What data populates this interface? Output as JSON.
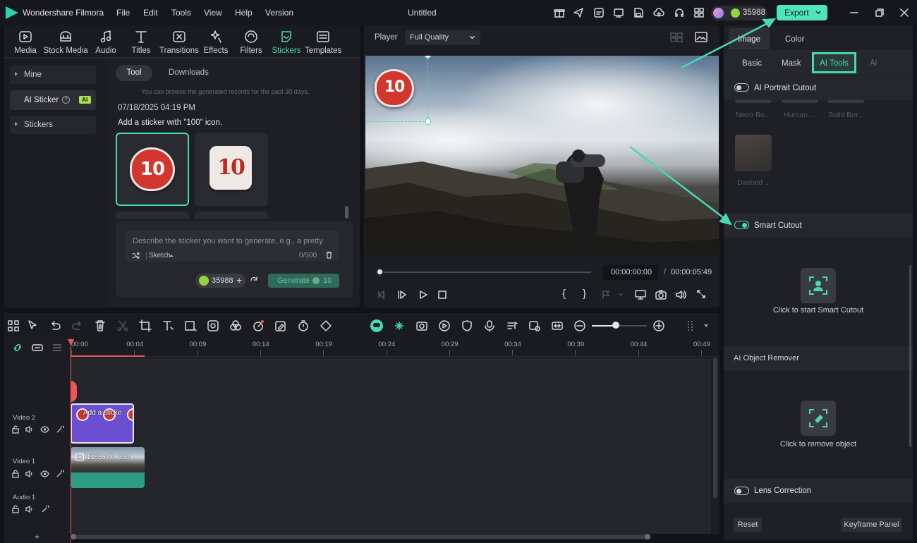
{
  "app": {
    "name": "Wondershare Filmora",
    "doc_title": "Untitled",
    "credits": "35988",
    "export_label": "Export"
  },
  "menu": [
    "File",
    "Edit",
    "Tools",
    "View",
    "Help",
    "Version"
  ],
  "toolbar": [
    {
      "label": "Media",
      "icon": "media-icon"
    },
    {
      "label": "Stock Media",
      "icon": "stock-media-icon"
    },
    {
      "label": "Audio",
      "icon": "audio-icon"
    },
    {
      "label": "Titles",
      "icon": "titles-icon"
    },
    {
      "label": "Transitions",
      "icon": "transitions-icon"
    },
    {
      "label": "Effects",
      "icon": "effects-icon"
    },
    {
      "label": "Filters",
      "icon": "filters-icon"
    },
    {
      "label": "Stickers",
      "icon": "stickers-icon",
      "active": true
    },
    {
      "label": "Templates",
      "icon": "templates-icon"
    }
  ],
  "sidebar": {
    "mine": "Mine",
    "ai_sticker": "AI Sticker",
    "ai_badge": "AI",
    "stickers": "Stickers"
  },
  "sticker_panel": {
    "tab_tool": "Tool",
    "tab_downloads": "Downloads",
    "notice": "You can browse the generated records for the past 30 days.",
    "date": "07/18/2025 04:19 PM",
    "prompt": "Add a sticker with \"100\" icon.",
    "input_placeholder": "Describe the sticker you want to generate, e.g., a pretty",
    "style": "Sketch",
    "counter": "0/500",
    "credits": "35988",
    "generate_label": "Generate",
    "generate_cost": "10",
    "sticker_text": "10"
  },
  "player": {
    "label": "Player",
    "quality": "Full Quality",
    "current_time": "00:00:00:00",
    "separator": "/",
    "total_time": "00:00:05:49",
    "playhead_fraction": 0.0
  },
  "timeline": {
    "ruler": [
      "00:00",
      "00:04",
      "00:09",
      "00:14",
      "00:19",
      "00:24",
      "00:29",
      "00:34",
      "00:39",
      "00:44",
      "00:49"
    ],
    "tracks": [
      {
        "name": "Video 2"
      },
      {
        "name": "Video 1"
      },
      {
        "name": "Audio 1"
      }
    ],
    "clip_sticker": "Add a sticke",
    "clip_video": "1388573...334",
    "add_track": "+"
  },
  "right_panel": {
    "tabs": [
      "Image",
      "Color"
    ],
    "subtabs": [
      "Basic",
      "Mask",
      "AI Tools",
      "Ai"
    ],
    "portrait_label": "AI Portrait Cutout",
    "effects": [
      "Neon Bo...",
      "Human ...",
      "Solid Bor...",
      "Dashed ..."
    ],
    "smart_cutout": "Smart Cutout",
    "smart_cutout_cta": "Click to start Smart Cutout",
    "object_remover": "AI Object Remover",
    "object_remover_cta": "Click to remove object",
    "lens_correction": "Lens Correction",
    "reset": "Reset",
    "keyframe": "Keyframe Panel"
  },
  "colors": {
    "accent": "#46d9b2",
    "sticker_clip": "#6b4fd0",
    "video_clip_bottom": "#2c9c82",
    "playhead": "#f05454"
  }
}
